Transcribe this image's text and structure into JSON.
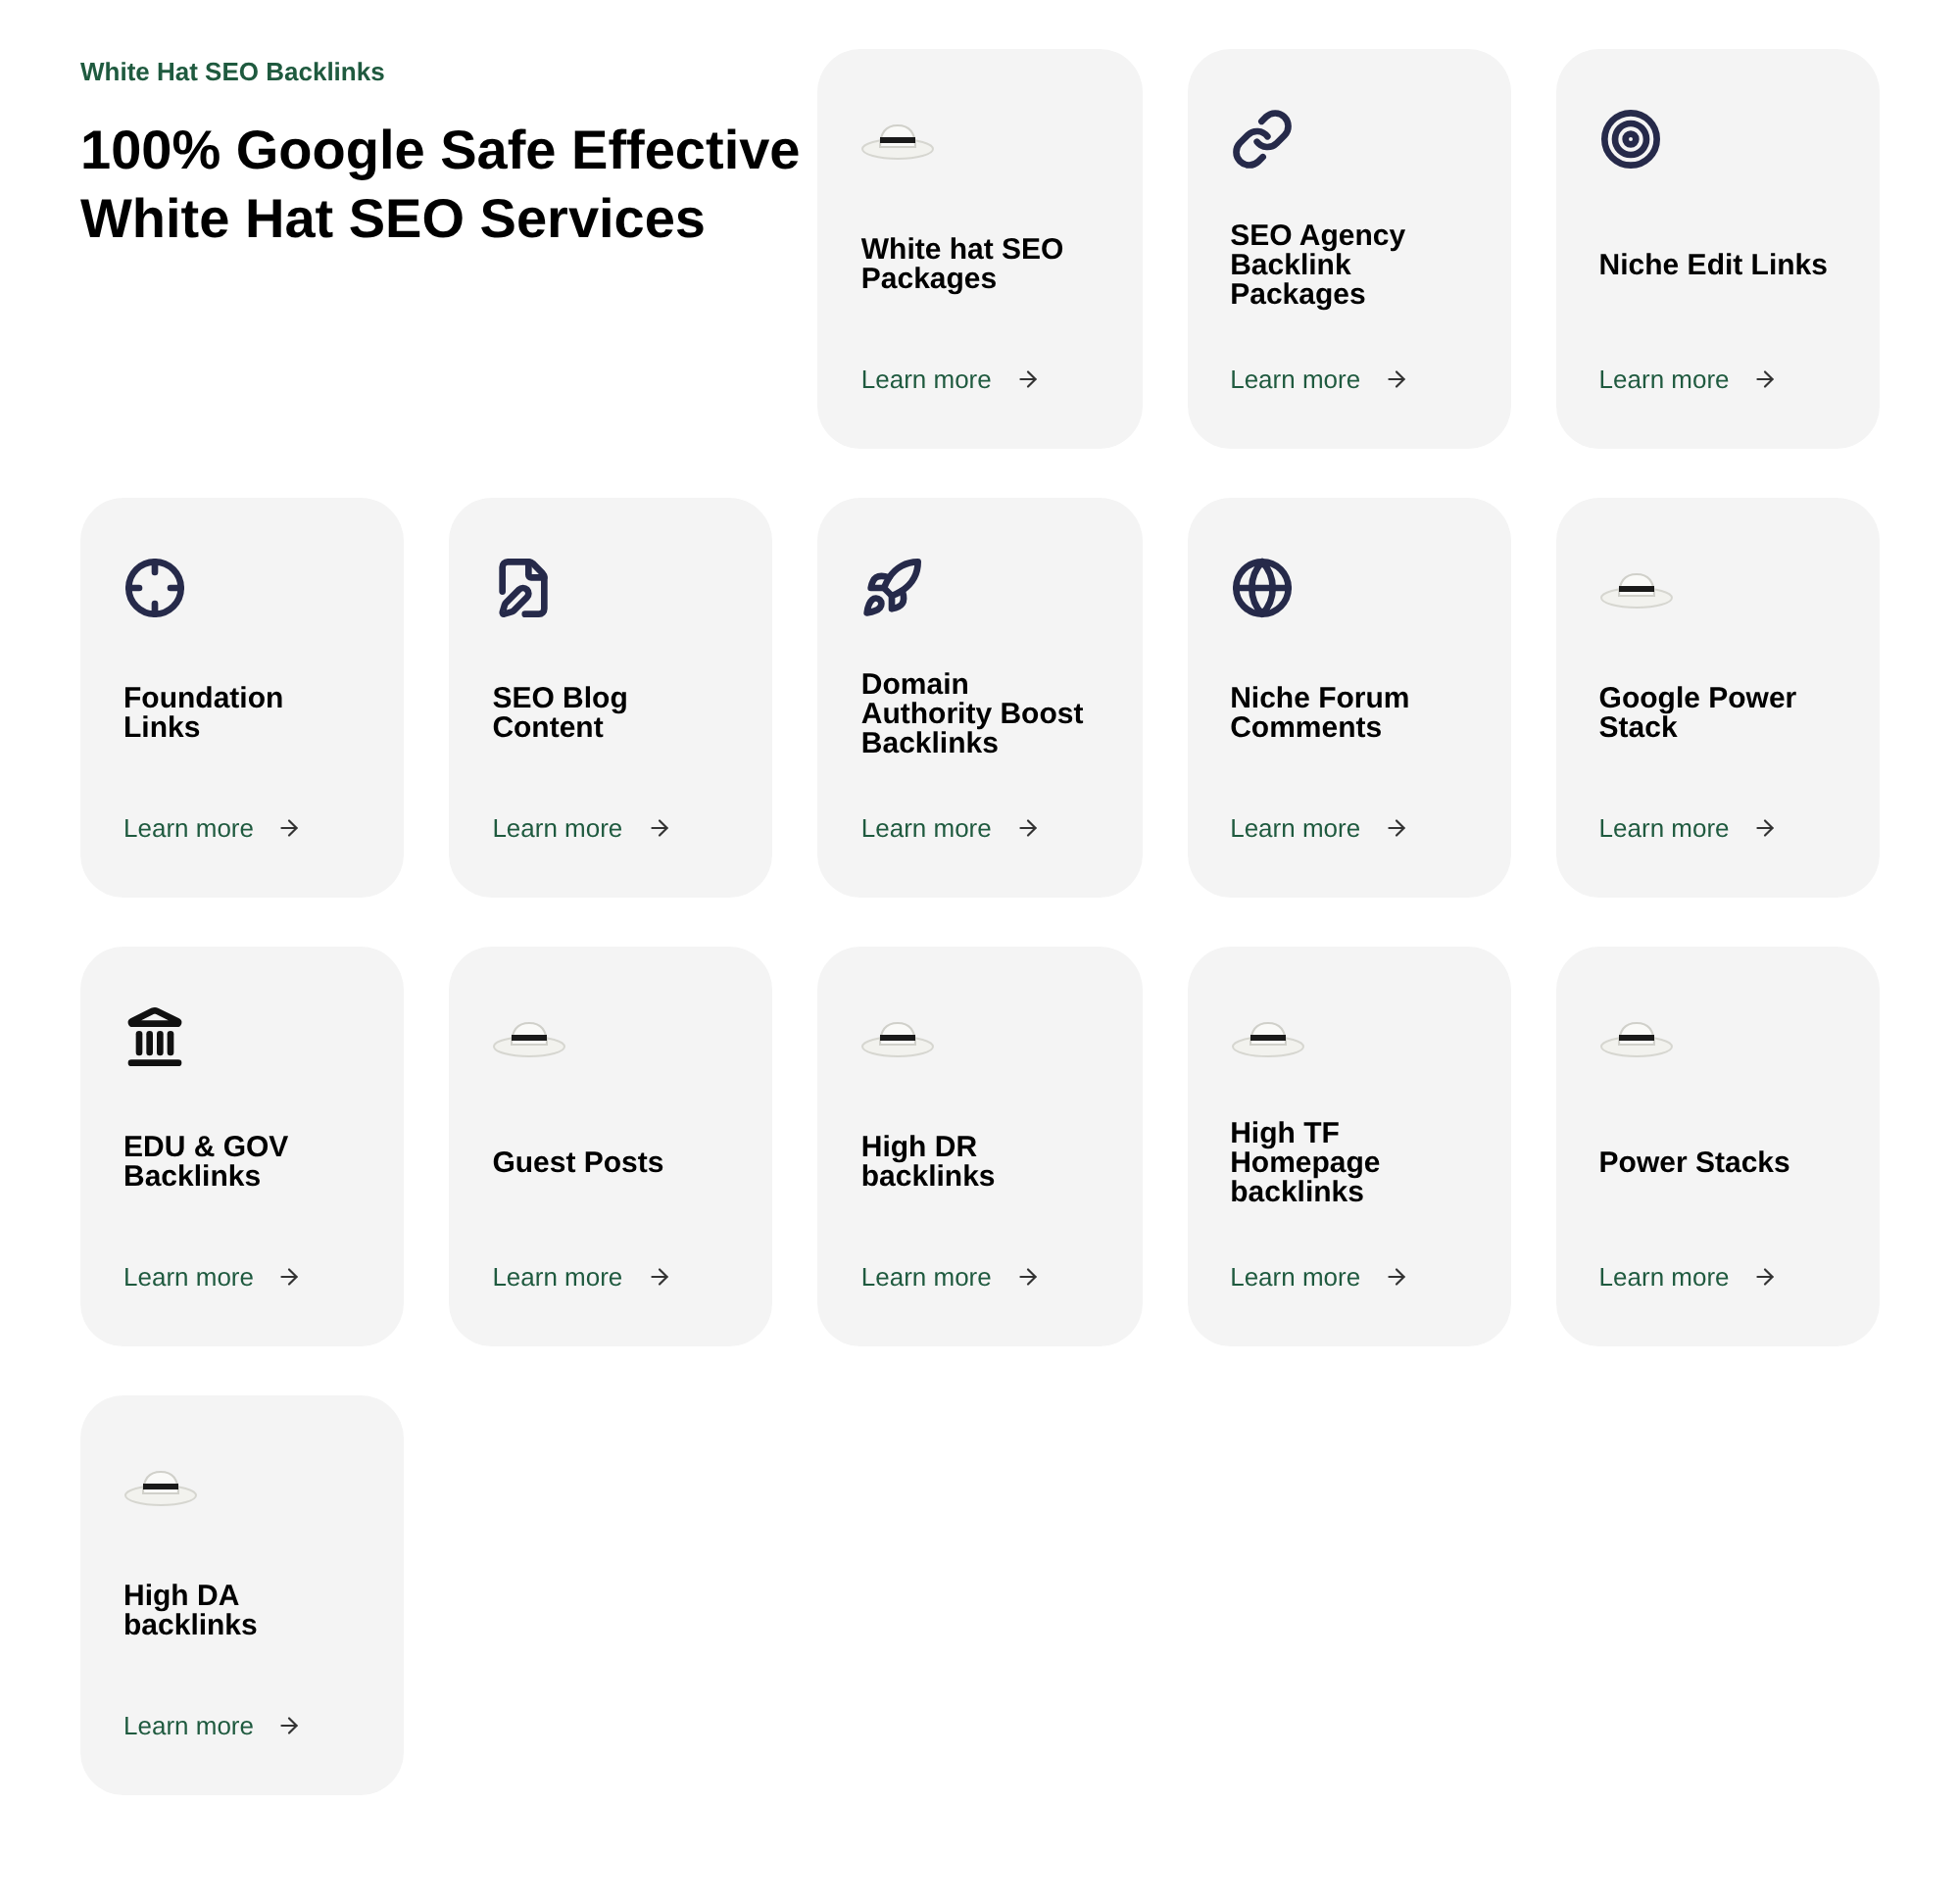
{
  "header": {
    "eyebrow": "White Hat SEO Backlinks",
    "title": "100% Google Safe Effective White Hat SEO Services"
  },
  "cards": [
    {
      "kind": "hat",
      "title": "White hat SEO Packages",
      "link": "Learn more"
    },
    {
      "kind": "link",
      "title": "SEO Agency Backlink Packages",
      "link": "Learn more"
    },
    {
      "kind": "target",
      "title": "Niche Edit Links",
      "link": "Learn more"
    },
    {
      "kind": "crosshair",
      "title": "Foundation Links",
      "link": "Learn more"
    },
    {
      "kind": "document",
      "title": "SEO Blog Content",
      "link": "Learn more"
    },
    {
      "kind": "rocket",
      "title": "Domain Authority Boost Backlinks",
      "link": "Learn more"
    },
    {
      "kind": "globe",
      "title": "Niche Forum Comments",
      "link": "Learn more"
    },
    {
      "kind": "hat",
      "title": "Google Power Stack",
      "link": "Learn more"
    },
    {
      "kind": "building",
      "title": "EDU & GOV Backlinks",
      "link": "Learn more"
    },
    {
      "kind": "hat",
      "title": "Guest Posts",
      "link": "Learn more"
    },
    {
      "kind": "hat",
      "title": "High DR backlinks",
      "link": "Learn more"
    },
    {
      "kind": "hat",
      "title": "High TF Homepage backlinks",
      "link": "Learn more"
    },
    {
      "kind": "hat",
      "title": "Power Stacks",
      "link": "Learn more"
    },
    {
      "kind": "hat",
      "title": "High DA backlinks",
      "link": "Learn more"
    }
  ]
}
